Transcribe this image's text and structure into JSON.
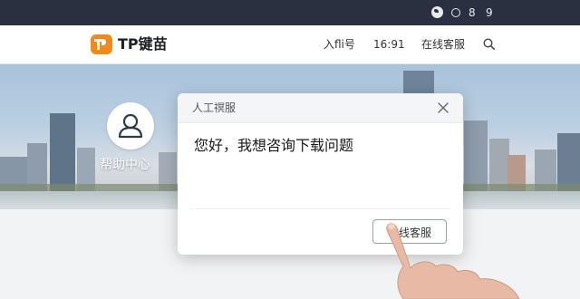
{
  "statusbar": {
    "icons": [
      "globe-icon",
      "ring-icon"
    ],
    "text1": "8",
    "text2": "9"
  },
  "navbar": {
    "logo_text": "TP键苗",
    "items": [
      {
        "label": "入fli号"
      },
      {
        "label": "16:91"
      },
      {
        "label": "在线客服"
      }
    ]
  },
  "banner": {
    "help_label": "帮助中心"
  },
  "dialog": {
    "title": "人工䄙服",
    "message": "您好，我想咨询下载问题",
    "button_label": "在线客服"
  },
  "colors": {
    "accent": "#f08a1c",
    "statusbar_bg": "#2b3040"
  }
}
